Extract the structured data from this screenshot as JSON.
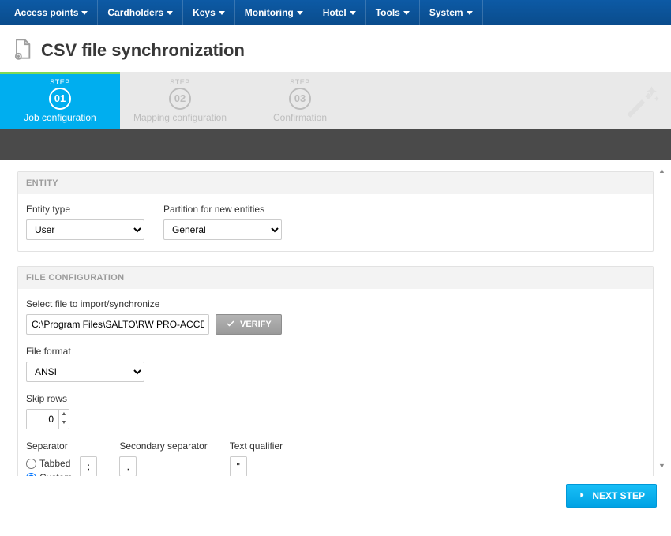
{
  "nav": {
    "items": [
      "Access points",
      "Cardholders",
      "Keys",
      "Monitoring",
      "Hotel",
      "Tools",
      "System"
    ]
  },
  "page": {
    "title": "CSV file synchronization"
  },
  "steps": {
    "label": "STEP",
    "items": [
      {
        "num": "01",
        "name": "Job configuration",
        "active": true
      },
      {
        "num": "02",
        "name": "Mapping configuration",
        "active": false
      },
      {
        "num": "03",
        "name": "Confirmation",
        "active": false
      }
    ]
  },
  "entity": {
    "header": "ENTITY",
    "type_label": "Entity type",
    "type_value": "User",
    "partition_label": "Partition for new entities",
    "partition_value": "General"
  },
  "fileconf": {
    "header": "FILE CONFIGURATION",
    "select_label": "Select file to import/synchronize",
    "file_path": "C:\\Program Files\\SALTO\\RW PRO-ACCESS\\Users.t",
    "verify_label": "VERIFY",
    "format_label": "File format",
    "format_value": "ANSI",
    "skip_label": "Skip rows",
    "skip_value": "0",
    "separator_label": "Separator",
    "tabbed_label": "Tabbed",
    "custom_label": "Custom",
    "custom_value": ";",
    "secondary_label": "Secondary separator",
    "secondary_value": ",",
    "qualifier_label": "Text qualifier",
    "qualifier_value": "\""
  },
  "footer": {
    "next_label": "NEXT STEP"
  }
}
